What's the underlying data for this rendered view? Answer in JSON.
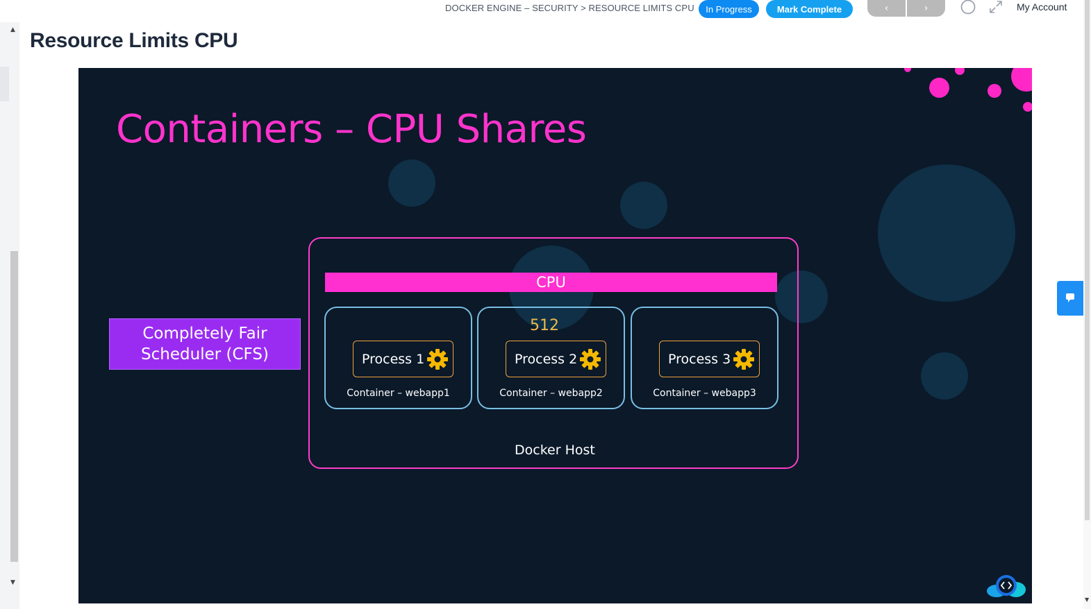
{
  "header": {
    "breadcrumb": "DOCKER ENGINE – SECURITY > RESOURCE LIMITS CPU",
    "status_button": "In Progress",
    "complete_button": "Mark Complete",
    "prev_glyph": "‹",
    "next_glyph": "›",
    "account_label": "My Account"
  },
  "page": {
    "title": "Resource Limits CPU"
  },
  "slide": {
    "title": "Containers – CPU Shares",
    "scheduler": "Completely Fair Scheduler (CFS)",
    "cpu_label": "CPU",
    "shares_value": "512",
    "host_label": "Docker Host",
    "containers": [
      {
        "process": "Process 1",
        "label": "Container – webapp1"
      },
      {
        "process": "Process 2",
        "label": "Container – webapp2"
      },
      {
        "process": "Process 3",
        "label": "Container – webapp3"
      }
    ]
  },
  "icons": {
    "theme": "moon-icon",
    "expand": "expand-icon",
    "chat": "chat-icon",
    "gear": "gear-icon",
    "logo": "code-cloud-logo"
  },
  "colors": {
    "accent_blue": "#0d8bf2",
    "slide_bg": "#0b1929",
    "title_pink": "#ff33cc",
    "cfs_purple": "#9a2cf2",
    "process_border": "#f0a23a",
    "container_border": "#79bfe3"
  }
}
